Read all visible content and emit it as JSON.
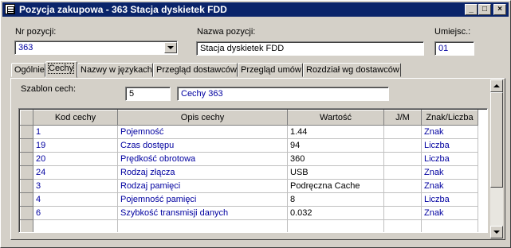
{
  "window": {
    "title": "Pozycja zakupowa - 363 Stacja dyskietek FDD"
  },
  "titlebar_buttons": {
    "minimize": "_",
    "maximize": "□",
    "close": "×"
  },
  "header": {
    "nr_label": "Nr pozycji:",
    "nr_value": "363",
    "name_label": "Nazwa pozycji:",
    "name_value": "Stacja dyskietek FDD",
    "loc_label": "Umiejsc.:",
    "loc_value": "01"
  },
  "tabs": [
    "Ogólnie",
    "Cechy",
    "Nazwy w językach",
    "Przegląd dostawców",
    "Przegląd umów",
    "Rozdział wg dostawców"
  ],
  "template": {
    "label": "Szablon cech:",
    "code": "5",
    "name": "Cechy 363"
  },
  "table": {
    "columns": [
      "Kod cechy",
      "Opis cechy",
      "Wartość",
      "J/M",
      "Znak/Liczba"
    ],
    "rows": [
      [
        "1",
        "Pojemność",
        "1.44",
        "",
        "Znak"
      ],
      [
        "19",
        "Czas dostępu",
        "94",
        "",
        "Liczba"
      ],
      [
        "20",
        "Prędkość obrotowa",
        "360",
        "",
        "Liczba"
      ],
      [
        "24",
        "Rodzaj złącza",
        "USB",
        "",
        "Znak"
      ],
      [
        "3",
        "Rodzaj pamięci",
        "Podręczna Cache",
        "",
        "Znak"
      ],
      [
        "4",
        "Pojemność pamięci",
        "8",
        "",
        "Liczba"
      ],
      [
        "6",
        "Szybkość transmisji danych",
        "0.032",
        "",
        "Znak"
      ],
      [
        "",
        "",
        "",
        "",
        ""
      ]
    ]
  },
  "colors": {
    "title_bg": "#0a246a",
    "link_text": "#0000a0",
    "face": "#d4d0c8"
  }
}
